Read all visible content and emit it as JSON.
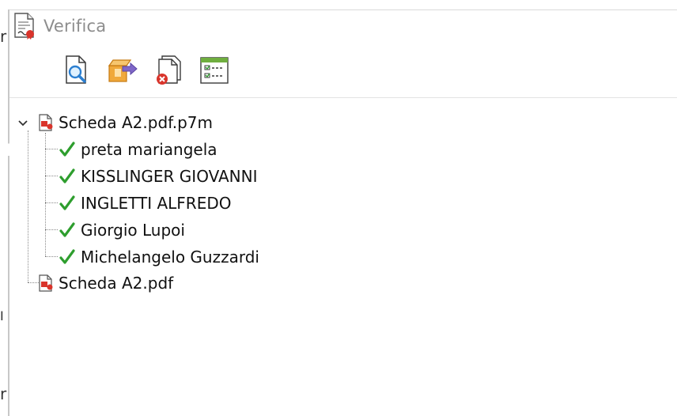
{
  "window": {
    "title": "Verifica",
    "title_icon": "signed-document-icon"
  },
  "toolbar": {
    "buttons": [
      {
        "icon": "view-document-icon"
      },
      {
        "icon": "extract-content-icon"
      },
      {
        "icon": "delete-document-icon"
      },
      {
        "icon": "checklist-report-icon"
      }
    ]
  },
  "tree": {
    "root": {
      "label": "Scheda A2.pdf.p7m",
      "icon": "pdf-signed-file-icon",
      "expanded": true,
      "signers": [
        {
          "label": "preta mariangela",
          "status": "valid"
        },
        {
          "label": "KISSLINGER GIOVANNI",
          "status": "valid"
        },
        {
          "label": "INGLETTI ALFREDO",
          "status": "valid"
        },
        {
          "label": "Giorgio Lupoi",
          "status": "valid"
        },
        {
          "label": "Michelangelo Guzzardi",
          "status": "valid"
        }
      ]
    },
    "content_file": {
      "label": "Scheda A2.pdf",
      "icon": "pdf-file-icon"
    }
  },
  "colors": {
    "check": "#2e9e2e",
    "title_text": "#8d8d8d",
    "pdf_red": "#d9342b"
  }
}
